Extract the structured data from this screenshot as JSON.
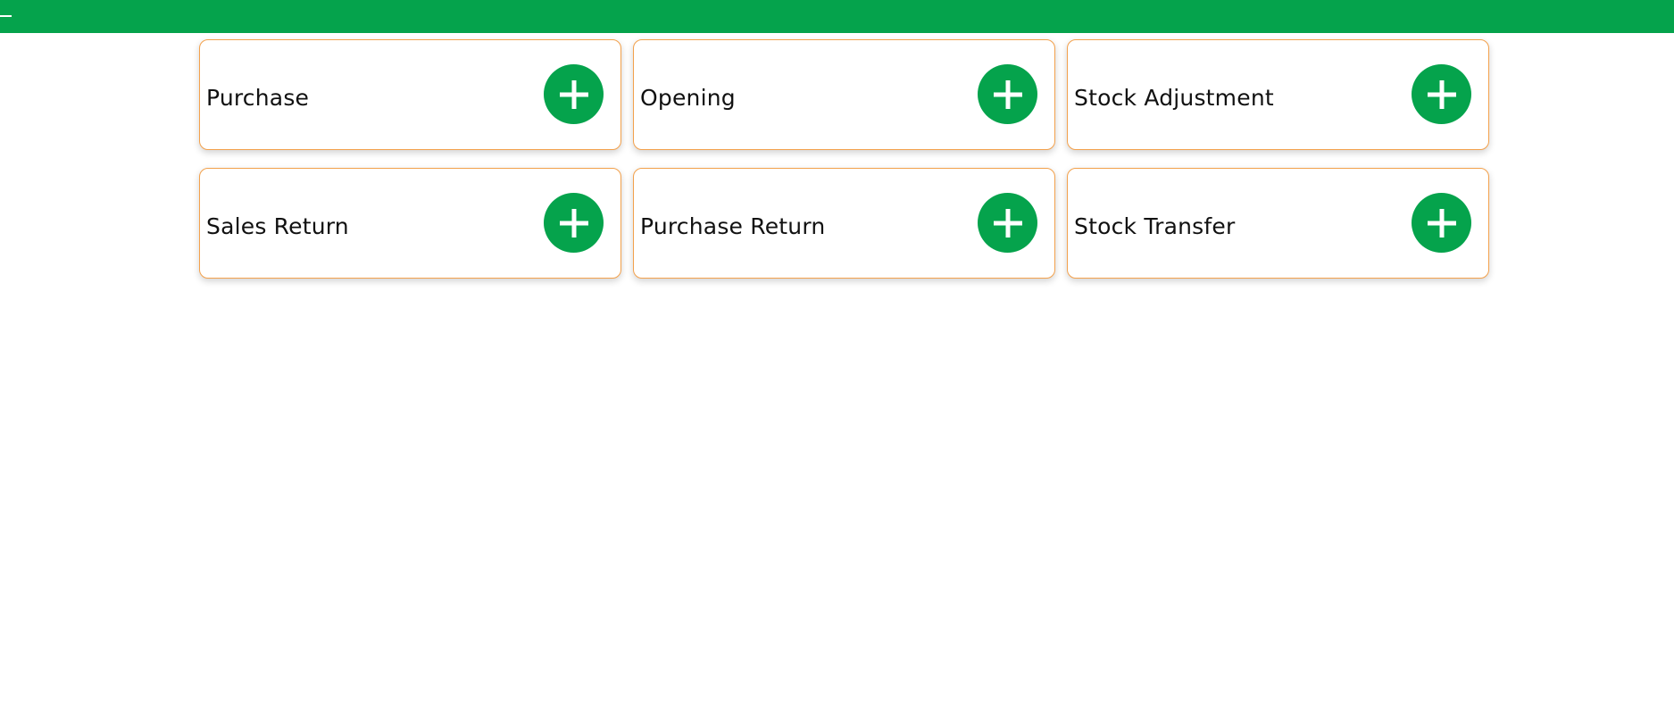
{
  "colors": {
    "topbar": "#05a34c",
    "card_border": "#f3a14c",
    "button": "#05a34c",
    "icon": "#ffffff"
  },
  "header": {
    "menu_icon": "minus-icon"
  },
  "cards": [
    {
      "label": "Purchase",
      "icon": "plus-icon"
    },
    {
      "label": "Opening",
      "icon": "plus-icon"
    },
    {
      "label": "Stock Adjustment",
      "icon": "plus-icon"
    },
    {
      "label": "Sales Return",
      "icon": "plus-icon"
    },
    {
      "label": "Purchase Return",
      "icon": "plus-icon"
    },
    {
      "label": "Stock Transfer",
      "icon": "plus-icon"
    }
  ]
}
